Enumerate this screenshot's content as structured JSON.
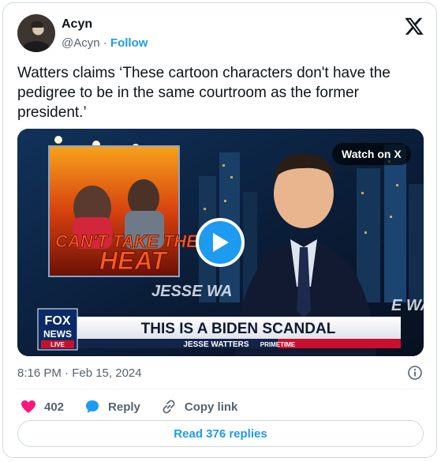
{
  "author": {
    "name": "Acyn",
    "handle": "@Acyn",
    "separator": "·",
    "follow_label": "Follow"
  },
  "tweet": {
    "text": "Watters claims ‘These cartoon characters don't have the pedigree to be in the same courtroom as the former president.’"
  },
  "media": {
    "watch_label": "Watch on X",
    "inset_caption_line1": "CAN'T TAKE THE",
    "inset_caption_line2": "HEAT",
    "lower_third_headline": "THIS IS A BIDEN SCANDAL",
    "lower_third_show": "JESSE WATTERS",
    "lower_third_tag": "PRIMETIME",
    "network_logo_line1": "FOX",
    "network_logo_line2": "NEWS",
    "network_logo_tag": "LIVE",
    "set_text_left": "JESSE WA",
    "set_text_right": "E WA"
  },
  "meta": {
    "timestamp": "8:16 PM · Feb 15, 2024"
  },
  "actions": {
    "like_count": "402",
    "reply_label": "Reply",
    "copy_label": "Copy link"
  },
  "read_replies_label": "Read 376 replies",
  "colors": {
    "accent": "#1d9bf0",
    "like": "#f91880",
    "text": "#0f1419",
    "muted": "#536471"
  }
}
